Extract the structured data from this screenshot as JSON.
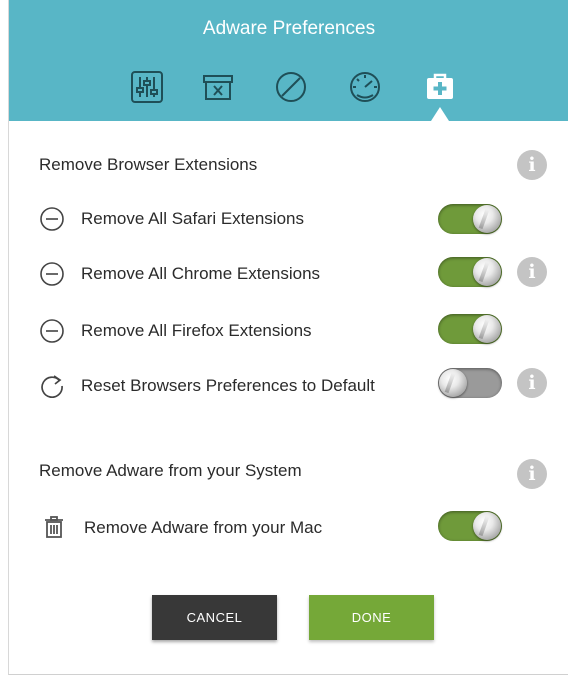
{
  "window": {
    "title": "Adware Preferences"
  },
  "tabs": [
    {
      "name": "sliders-icon"
    },
    {
      "name": "archive-x-icon"
    },
    {
      "name": "block-icon"
    },
    {
      "name": "speed-gauge-icon"
    },
    {
      "name": "first-aid-kit-icon",
      "active": true
    }
  ],
  "browser_section": {
    "label": "Remove Browser Extensions",
    "rows": [
      {
        "icon": "minus-circle-icon",
        "label": "Remove All Safari Extensions",
        "enabled": true,
        "info": false
      },
      {
        "icon": "minus-circle-icon",
        "label": "Remove All Chrome Extensions",
        "enabled": true,
        "info": true
      },
      {
        "icon": "minus-circle-icon",
        "label": "Remove All Firefox Extensions",
        "enabled": true,
        "info": false
      },
      {
        "icon": "refresh-icon",
        "label": "Reset Browsers Preferences to Default",
        "enabled": false,
        "info": true
      }
    ]
  },
  "system_section": {
    "label": "Remove Adware from your System",
    "rows": [
      {
        "icon": "trash-icon",
        "label": "Remove Adware from your Mac",
        "enabled": true,
        "info": false
      }
    ]
  },
  "info_glyph": "i",
  "buttons": {
    "cancel": "CANCEL",
    "done": "DONE"
  },
  "colors": {
    "header": "#58b6c6",
    "toggle_on": "#6f9a3a",
    "toggle_off": "#9a9a9a",
    "cancel": "#383838",
    "done": "#75a838"
  }
}
